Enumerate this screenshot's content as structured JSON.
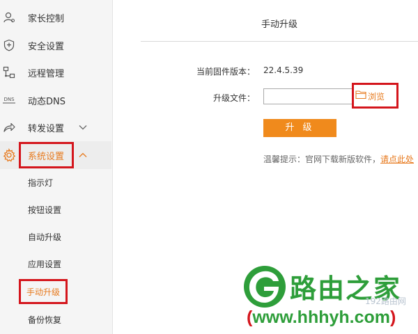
{
  "sidebar": {
    "items": [
      {
        "label": "家长控制",
        "icon": "person-icon"
      },
      {
        "label": "安全设置",
        "icon": "shield-icon"
      },
      {
        "label": "远程管理",
        "icon": "remote-icon"
      },
      {
        "label": "动态DNS",
        "icon": "dns-icon",
        "icon_text": "DNS"
      },
      {
        "label": "转发设置",
        "icon": "forward-icon"
      },
      {
        "label": "系统设置",
        "icon": "gear-icon"
      }
    ],
    "sub_items": [
      {
        "label": "指示灯"
      },
      {
        "label": "按钮设置"
      },
      {
        "label": "自动升级"
      },
      {
        "label": "应用设置"
      },
      {
        "label": "手动升级"
      },
      {
        "label": "备份恢复"
      }
    ],
    "active_item": "系统设置",
    "active_sub_item": "手动升级"
  },
  "main": {
    "title": "手动升级",
    "firmware_label": "当前固件版本：",
    "firmware_version": "22.4.5.39",
    "file_label": "升级文件：",
    "file_value": "",
    "browse_label": "浏览",
    "upgrade_button": "升 级",
    "tip_prefix": "温馨提示：官网下载新版软件，",
    "tip_link": "请点此处"
  },
  "watermark": {
    "brand": "路由之家",
    "domain": "www.hhhyh.com",
    "paren_open": "(",
    "paren_close": ")",
    "faint_text": "192路由网"
  },
  "colors": {
    "accent": "#e77a1e",
    "button": "#f08a1c",
    "highlight_box": "#d4151c",
    "watermark_green": "#2e9e3a",
    "sidebar_bg": "#f5f5f5"
  }
}
